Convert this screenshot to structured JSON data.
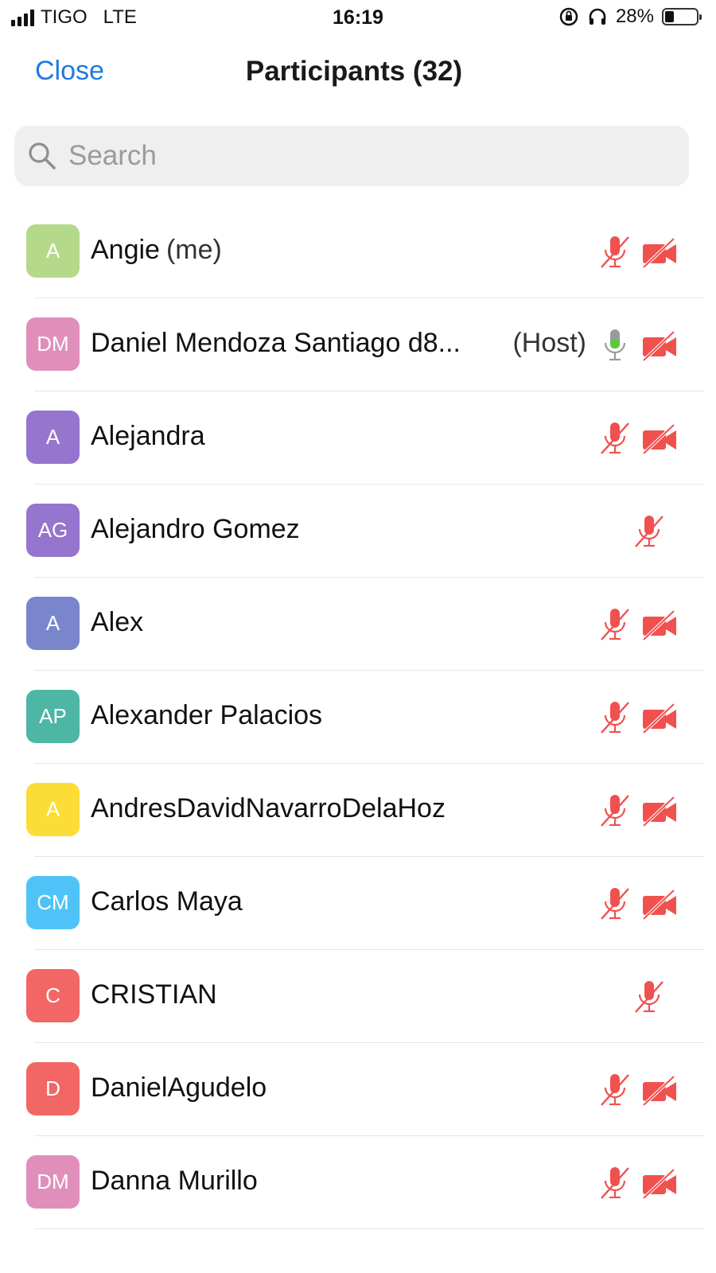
{
  "status_bar": {
    "carrier": "TIGO",
    "network": "LTE",
    "time": "16:19",
    "battery_percent": "28%",
    "battery_level": 0.28,
    "icons": [
      "signal-icon",
      "orientation-lock-icon",
      "headphones-icon",
      "battery-icon"
    ]
  },
  "header": {
    "close_label": "Close",
    "title": "Participants (32)"
  },
  "search": {
    "placeholder": "Search"
  },
  "colors": {
    "link_blue": "#1f7ae0",
    "muted_red": "#f0514f",
    "active_green": "#5ac93b"
  },
  "participants": [
    {
      "initials": "A",
      "name": "Angie",
      "suffix": "(me)",
      "role": "",
      "avatar_color": "#b5d98a",
      "mic": "muted",
      "video": "off"
    },
    {
      "initials": "DM",
      "name": "Daniel Mendoza Santiago d8...",
      "suffix": "",
      "role": "(Host)",
      "avatar_color": "#e08fbb",
      "mic": "active",
      "video": "off"
    },
    {
      "initials": "A",
      "name": "Alejandra",
      "suffix": "",
      "role": "",
      "avatar_color": "#9575cd",
      "mic": "muted",
      "video": "off"
    },
    {
      "initials": "AG",
      "name": "Alejandro Gomez",
      "suffix": "",
      "role": "",
      "avatar_color": "#9575cd",
      "mic": "muted",
      "video": "none"
    },
    {
      "initials": "A",
      "name": "Alex",
      "suffix": "",
      "role": "",
      "avatar_color": "#7986cb",
      "mic": "muted",
      "video": "off"
    },
    {
      "initials": "AP",
      "name": "Alexander Palacios",
      "suffix": "",
      "role": "",
      "avatar_color": "#4db6a4",
      "mic": "muted",
      "video": "off"
    },
    {
      "initials": "A",
      "name": "AndresDavidNavarroDelaHoz",
      "suffix": "",
      "role": "",
      "avatar_color": "#fcdc36",
      "mic": "muted",
      "video": "off"
    },
    {
      "initials": "CM",
      "name": "Carlos Maya",
      "suffix": "",
      "role": "",
      "avatar_color": "#4fc3f7",
      "mic": "muted",
      "video": "off"
    },
    {
      "initials": "C",
      "name": "CRISTIAN",
      "suffix": "",
      "role": "",
      "avatar_color": "#f26666",
      "mic": "muted",
      "video": "none"
    },
    {
      "initials": "D",
      "name": "DanielAgudelo",
      "suffix": "",
      "role": "",
      "avatar_color": "#f26666",
      "mic": "muted",
      "video": "off"
    },
    {
      "initials": "DM",
      "name": "Danna Murillo",
      "suffix": "",
      "role": "",
      "avatar_color": "#e08fbb",
      "mic": "muted",
      "video": "off"
    }
  ]
}
